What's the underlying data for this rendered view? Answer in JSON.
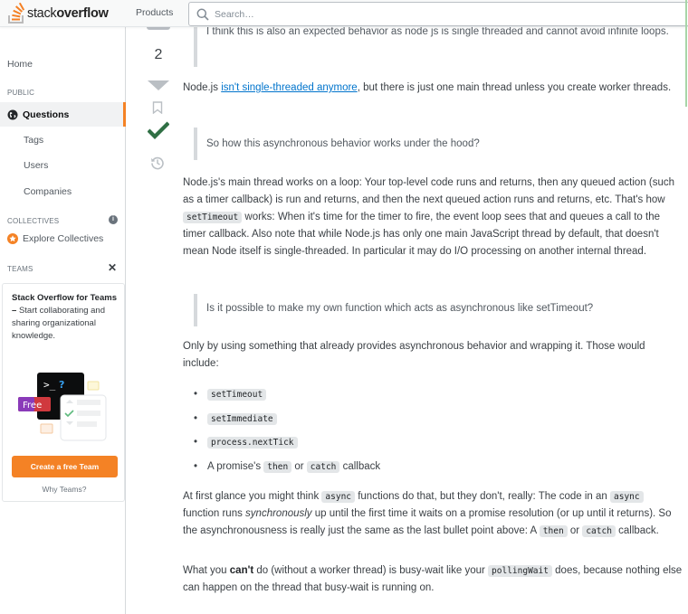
{
  "header": {
    "logo_prefix": "stack",
    "logo_bold": "overflow",
    "products_label": "Products",
    "search_placeholder": "Search…"
  },
  "sidebar": {
    "home": "Home",
    "public_label": "PUBLIC",
    "questions": "Questions",
    "tags": "Tags",
    "users": "Users",
    "companies": "Companies",
    "collectives_label": "COLLECTIVES",
    "info_glyph": "i",
    "explore_collectives": "Explore Collectives",
    "teams_label": "TEAMS",
    "close_glyph": "✕",
    "teams_card": {
      "title": "Stack Overflow for Teams",
      "dash": " – ",
      "description": "Start collaborating and sharing organizational knowledge.",
      "free_badge": "Free",
      "terminal_prompt": ">_",
      "terminal_q": "?",
      "cta_button": "Create a free Team",
      "why_link": "Why Teams?"
    }
  },
  "votes": {
    "count": "2"
  },
  "post": {
    "quote1": "I think this is also an expected behavior as node js is single threaded and cannot avoid infinite loops.",
    "p1_before": "Node.js ",
    "p1_link": "isn't single-threaded anymore",
    "p1_after": ", but there is just one main thread unless you create worker threads.",
    "quote2": "So how this asynchronous behavior works under the hood?",
    "p2_a": "Node.js's main thread works on a loop: Your top-level code runs and returns, then any queued action (such as a timer callback) is run and returns, and then the next queued action runs and returns, etc. That's how ",
    "p2_code": "setTimeout",
    "p2_b": " works: When it's time for the timer to fire, the event loop sees that and queues a call to the timer callback. Also note that while Node.js has only one main JavaScript thread by default, that doesn't mean Node itself is single-threaded. In particular it may do I/O processing on another internal thread.",
    "quote3": "Is it possible to make my own function which acts as asynchronous like setTimeout?",
    "p3": "Only by using something that already provides asynchronous behavior and wrapping it. Those would include:",
    "list": [
      {
        "code": "setTimeout"
      },
      {
        "code": "setImmediate"
      },
      {
        "code": "process.nextTick"
      }
    ],
    "list_last": {
      "before": "A promise's ",
      "code1": "then",
      "mid": " or ",
      "code2": "catch",
      "after": " callback"
    },
    "p4_a": "At first glance you might think ",
    "p4_code1": "async",
    "p4_b": " functions do that, but they don't, really: The code in an ",
    "p4_code2": "async",
    "p4_c": " function runs ",
    "p4_em": "synchronously",
    "p4_d": " up until the first time it waits on a promise resolution (or up until it returns). So the asynchronousness is really just the same as the last bullet point above: A ",
    "p4_code3": "then",
    "p4_e": " or ",
    "p4_code4": "catch",
    "p4_f": " callback.",
    "p5_a": "What you ",
    "p5_strong": "can't",
    "p5_b": " do (without a worker thread) is busy-wait like your ",
    "p5_code": "pollingWait",
    "p5_c": " does, because nothing else can happen on the thread that busy-wait is running on."
  },
  "colors": {
    "accent_orange": "#f48225",
    "accepted_green": "#2f6f44",
    "link_blue": "#0074cc"
  }
}
